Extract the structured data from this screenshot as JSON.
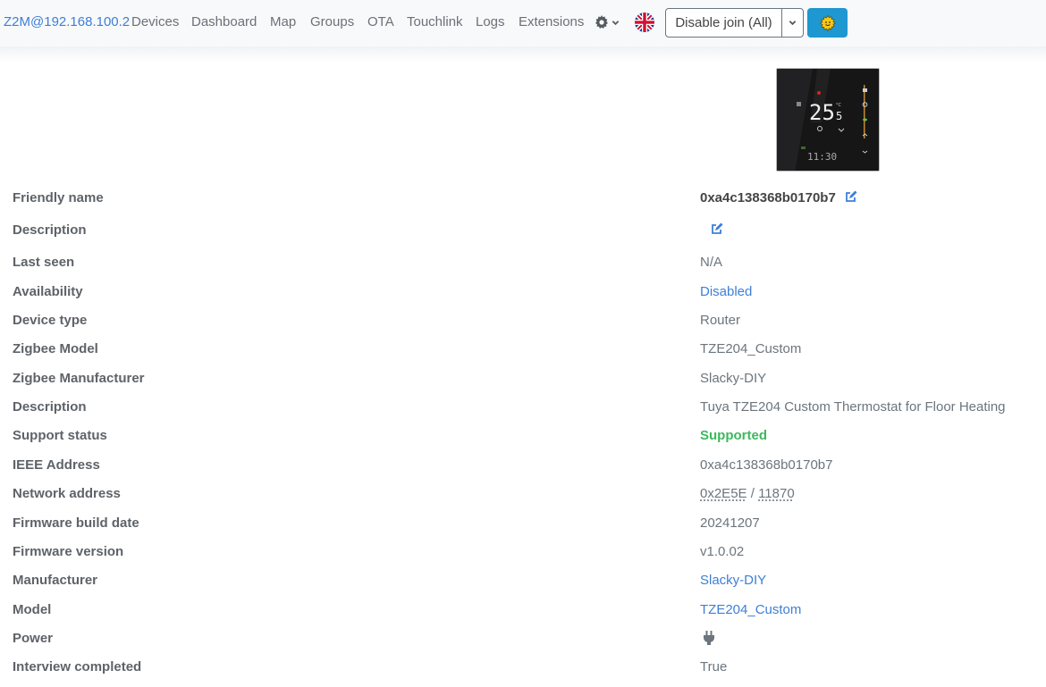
{
  "navbar": {
    "brand": "Z2M@192.168.100.2",
    "links": [
      "Devices",
      "Dashboard",
      "Map",
      "Groups",
      "OTA",
      "Touchlink",
      "Logs",
      "Extensions"
    ],
    "settings_icon": "gear-icon",
    "language_icon": "uk-flag-icon",
    "join_button": "Disable join (All)",
    "theme_icon": "sun-icon"
  },
  "device": {
    "image_alt": "Thermostat device image",
    "display_temp": "25",
    "display_decimal": "5",
    "display_time": "11:30"
  },
  "colors": {
    "link": "#3e7fd6",
    "success": "#3db85e",
    "theme_button": "#1f97d1"
  },
  "details": [
    {
      "label": "Friendly name",
      "value": "0xa4c138368b0170b7",
      "editable": true
    },
    {
      "label": "Description",
      "value": "",
      "editable": true
    },
    {
      "label": "Last seen",
      "value": "N/A"
    },
    {
      "label": "Availability",
      "value": "Disabled",
      "link": true
    },
    {
      "label": "Device type",
      "value": "Router"
    },
    {
      "label": "Zigbee Model",
      "value": "TZE204_Custom"
    },
    {
      "label": "Zigbee Manufacturer",
      "value": "Slacky-DIY"
    },
    {
      "label": "Description",
      "value": "Tuya TZE204 Custom Thermostat for Floor Heating"
    },
    {
      "label": "Support status",
      "value": "Supported",
      "status": "success"
    },
    {
      "label": "IEEE Address",
      "value": "0xa4c138368b0170b7"
    },
    {
      "label": "Network address",
      "value_hex": "0x2E5E",
      "separator": " / ",
      "value_dec": "11870"
    },
    {
      "label": "Firmware build date",
      "value": "20241207"
    },
    {
      "label": "Firmware version",
      "value": "v1.0.02"
    },
    {
      "label": "Manufacturer",
      "value": "Slacky-DIY",
      "link": true
    },
    {
      "label": "Model",
      "value": "TZE204_Custom",
      "link": true
    },
    {
      "label": "Power",
      "value_icon": "plug-icon"
    },
    {
      "label": "Interview completed",
      "value": "True"
    }
  ]
}
